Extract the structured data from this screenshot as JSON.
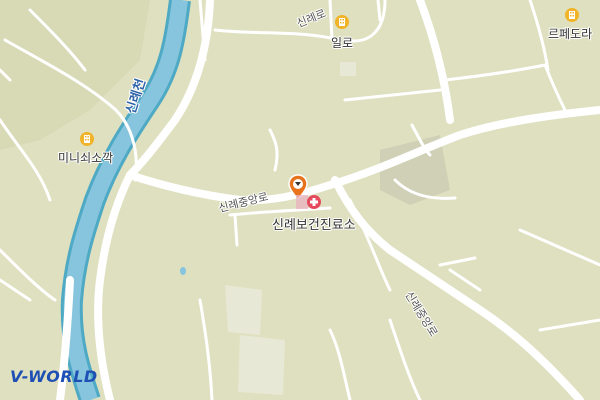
{
  "map": {
    "background": "#dfe0bf",
    "road_color": "#ffffff",
    "river_color": "#86c5dd",
    "river_edge_color": "#4ea9c4",
    "river_label": "신례천",
    "roads": {
      "main_west": "신례중앙로",
      "main_east": "신례중앙로",
      "north": "신례로"
    },
    "places": [
      {
        "name": "일로",
        "icon": "building-icon"
      },
      {
        "name": "르페도라",
        "icon": "building-icon"
      },
      {
        "name": "미니쇠소깍",
        "icon": "building-icon"
      },
      {
        "name": "신례보건진료소",
        "icon": "hospital-icon"
      }
    ],
    "selected_marker": {
      "icon": "location-pin-icon",
      "color": "#e8731d"
    },
    "logo": "V-WORLD"
  }
}
